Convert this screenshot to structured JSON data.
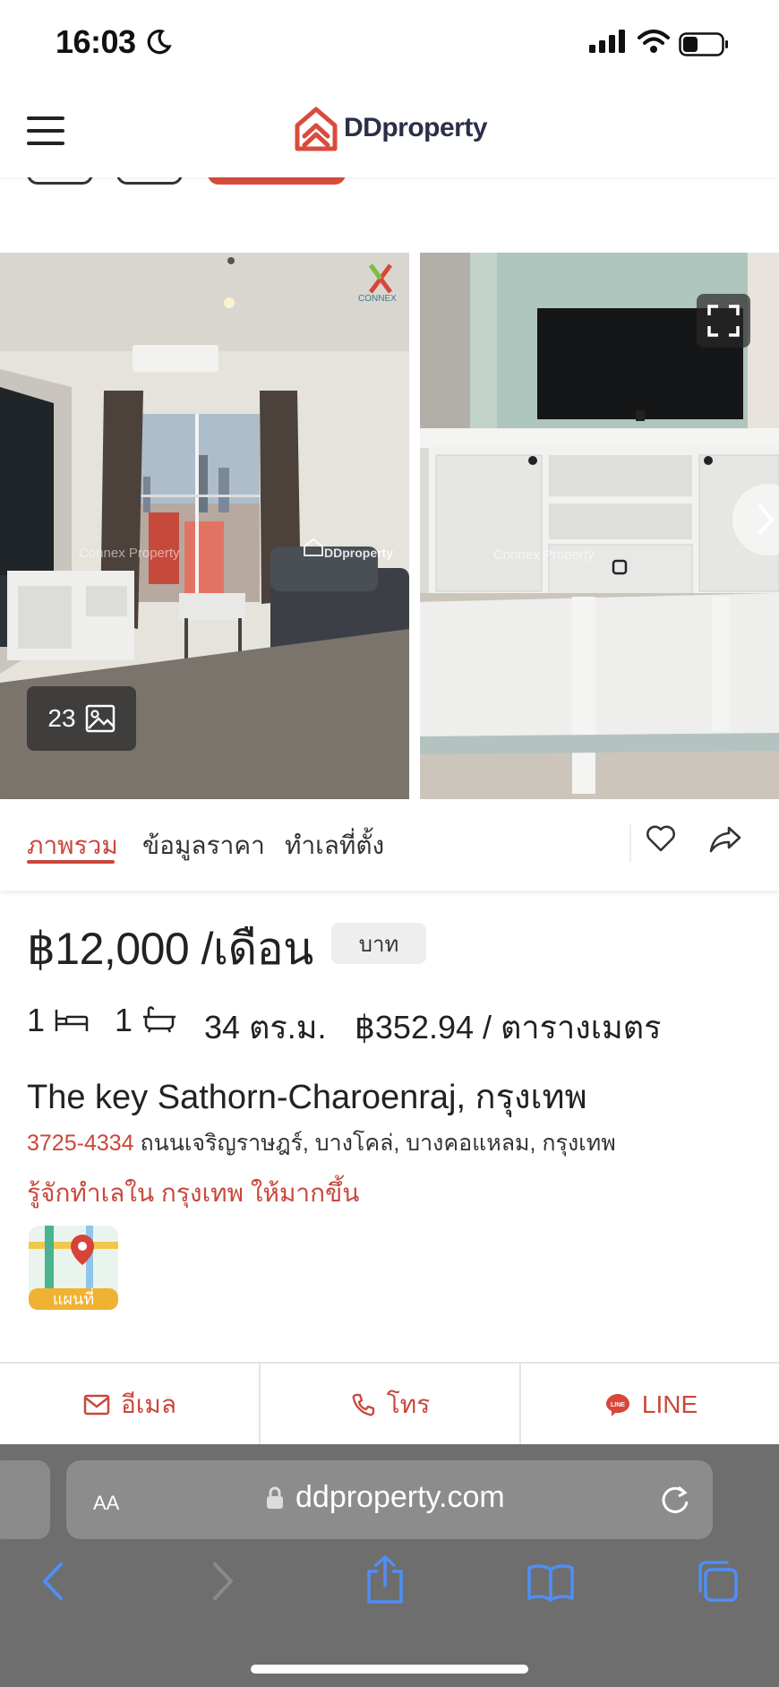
{
  "status_bar": {
    "time": "16:03"
  },
  "header": {
    "brand": "DDproperty",
    "brand_color": "#d94b3c"
  },
  "gallery": {
    "photo_count": "23",
    "watermark_1": "Connex Property",
    "watermark_2": "DDproperty",
    "logo_text": "CONNEX"
  },
  "tabs": [
    {
      "label": "ภาพรวม",
      "active": true
    },
    {
      "label": "ข้อมูลราคา",
      "active": false
    },
    {
      "label": "ทำเลที่ตั้ง",
      "active": false
    }
  ],
  "listing": {
    "price": "฿12,000 /เดือน",
    "currency_chip": "บาท",
    "bedrooms": "1",
    "bathrooms": "1",
    "area": "34 ตร.ม.",
    "price_per_sqm": "฿352.94 / ตารางเมตร",
    "title": "The key Sathorn-Charoenraj, กรุงเทพ",
    "address_code": "3725-4334",
    "address_rest": " ถนนเจริญราษฎร์, บางโคล่, บางคอแหลม, กรุงเทพ",
    "learn_more": "รู้จักทำเลใน กรุงเทพ ให้มากขึ้น",
    "map_label": "แผนที่"
  },
  "contact": {
    "email": "อีเมล",
    "call": "โทร",
    "line": "LINE"
  },
  "browser": {
    "aa": "AA",
    "url": "ddproperty.com"
  },
  "colors": {
    "accent": "#c9483b",
    "safari_bar": "#6e6e6e",
    "safari_icon": "#4f8ef7"
  }
}
